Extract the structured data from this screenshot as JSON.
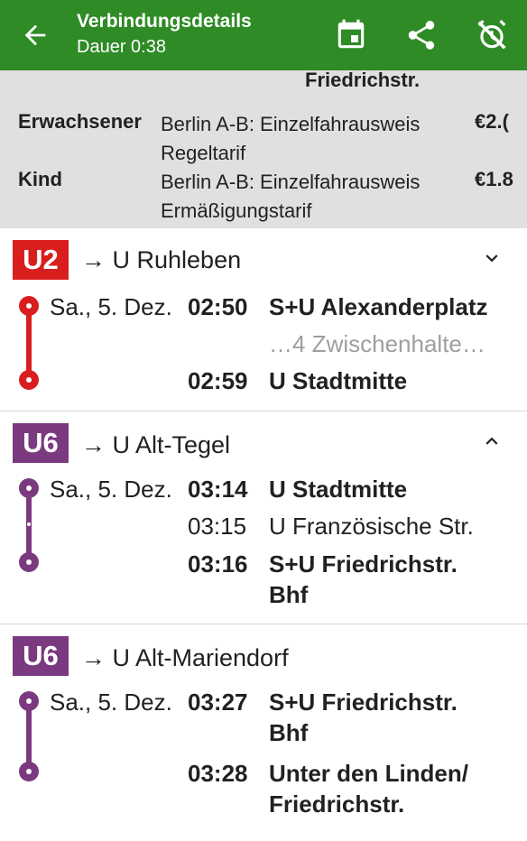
{
  "appbar": {
    "title": "Verbindungsdetails",
    "subtitle": "Dauer 0:38",
    "icons": [
      "back-arrow-icon",
      "calendar-icon",
      "share-icon",
      "alarm-off-icon"
    ]
  },
  "fare": {
    "cut_off_destination": "Friedrichstr.",
    "rows": [
      {
        "passenger": "Erwachsener",
        "product": "Berlin A-B: Einzelfahrausweis",
        "tariff": "Regeltarif",
        "price": "€2.("
      },
      {
        "passenger": "Kind",
        "product": "Berlin A-B: Einzelfahrausweis",
        "tariff": "Ermäßigungstarif",
        "price": "€1.8"
      }
    ]
  },
  "colors": {
    "green": "#2e8b25",
    "u2": "#d91e1e",
    "u6": "#7b3a80"
  },
  "legs": [
    {
      "line": "U2",
      "direction": "→ U Ruhleben",
      "expanded": false,
      "stops": [
        {
          "date": "Sa., 5. Dez.",
          "time": "02:50",
          "station": "S+U Alexanderplatz"
        },
        {
          "time": "02:59",
          "station": "U Stadtmitte"
        }
      ],
      "intermediate": "…4 Zwischenhalte…"
    },
    {
      "line": "U6",
      "direction": "→ U Alt-Tegel",
      "expanded": true,
      "stops": [
        {
          "date": "Sa., 5. Dez.",
          "time": "03:14",
          "station": "U Stadtmitte"
        },
        {
          "time": "03:15",
          "station": "U Französische Str."
        },
        {
          "time": "03:16",
          "station_line1": "S+U Friedrichstr.",
          "station_line2": "Bhf"
        }
      ]
    },
    {
      "line": "U6",
      "direction": "→ U Alt-Mariendorf",
      "stops": [
        {
          "date": "Sa., 5. Dez.",
          "time": "03:27",
          "station_line1": "S+U Friedrichstr.",
          "station_line2": "Bhf"
        },
        {
          "time": "03:28",
          "station_line1": "Unter den Linden/",
          "station_line2": "Friedrichstr."
        }
      ]
    }
  ]
}
